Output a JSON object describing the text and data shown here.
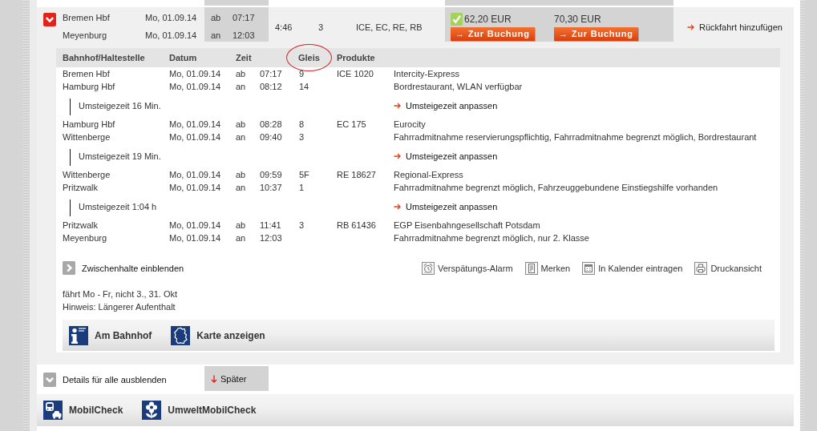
{
  "connection": {
    "expanded": true,
    "stations": [
      {
        "name": "Bremen Hbf",
        "date": "Mo, 01.09.14",
        "event": "ab",
        "time": "07:17"
      },
      {
        "name": "Meyenburg",
        "date": "Mo, 01.09.14",
        "event": "an",
        "time": "12:03"
      }
    ],
    "duration": "4:46",
    "changes": "3",
    "products": "ICE, EC, RE, RB",
    "fares": [
      {
        "price": "62,20 EUR",
        "selected": true,
        "button": "→ Zur Buchung"
      },
      {
        "price": "70,30 EUR",
        "selected": false,
        "button": "→ Zur Buchung"
      }
    ],
    "return_link": "Rückfahrt hinzufügen"
  },
  "details": {
    "columns": [
      {
        "label": "Bahnhof/Haltestelle",
        "circled": false
      },
      {
        "label": "Datum",
        "circled": false
      },
      {
        "label": "Zeit",
        "circled": false
      },
      {
        "label": "Gleis",
        "circled": true
      },
      {
        "label": "Produkte",
        "circled": false
      }
    ],
    "sections": [
      {
        "kind": "leg",
        "train": "ICE 1020",
        "stops": [
          {
            "station": "Bremen Hbf",
            "date": "Mo, 01.09.14",
            "event": "ab",
            "time": "07:17",
            "platform": "9",
            "info": "Intercity-Express"
          },
          {
            "station": "Hamburg Hbf",
            "date": "Mo, 01.09.14",
            "event": "an",
            "time": "08:12",
            "platform": "14",
            "info": "Bordrestaurant, WLAN verfügbar"
          }
        ]
      },
      {
        "kind": "transfer",
        "text": "Umsteigezeit 16 Min.",
        "link": "Umsteigezeit anpassen"
      },
      {
        "kind": "leg",
        "train": "EC 175",
        "stops": [
          {
            "station": "Hamburg Hbf",
            "date": "Mo, 01.09.14",
            "event": "ab",
            "time": "08:28",
            "platform": "8",
            "info": "Eurocity"
          },
          {
            "station": "Wittenberge",
            "date": "Mo, 01.09.14",
            "event": "an",
            "time": "09:40",
            "platform": "3",
            "info": "Fahrradmitnahme reservierungspflichtig, Fahrradmitnahme begrenzt möglich, Bordrestaurant"
          }
        ]
      },
      {
        "kind": "transfer",
        "text": "Umsteigezeit 19 Min.",
        "link": "Umsteigezeit anpassen"
      },
      {
        "kind": "leg",
        "train": "RE 18627",
        "stops": [
          {
            "station": "Wittenberge",
            "date": "Mo, 01.09.14",
            "event": "ab",
            "time": "09:59",
            "platform": "5F",
            "info": "Regional-Express"
          },
          {
            "station": "Pritzwalk",
            "date": "Mo, 01.09.14",
            "event": "an",
            "time": "10:37",
            "platform": "1",
            "info": "Fahrradmitnahme begrenzt möglich, Fahrzeuggebundene Einstiegshilfe vorhanden"
          }
        ]
      },
      {
        "kind": "transfer",
        "text": "Umsteigezeit 1:04 h",
        "link": "Umsteigezeit anpassen"
      },
      {
        "kind": "leg",
        "train": "RB 61436",
        "stops": [
          {
            "station": "Pritzwalk",
            "date": "Mo, 01.09.14",
            "event": "ab",
            "time": "11:41",
            "platform": "3",
            "info": "EGP Eisenbahngesellschaft Potsdam"
          },
          {
            "station": "Meyenburg",
            "date": "Mo, 01.09.14",
            "event": "an",
            "time": "12:03",
            "info": "Fahrradmitnahme begrenzt möglich, nur 2. Klasse"
          }
        ]
      }
    ],
    "stops_toggle": {
      "label": "Zwischenhalte einblenden",
      "expanded": false
    },
    "tools": [
      {
        "kind": "alarm",
        "label": "Verspätungs-Alarm"
      },
      {
        "kind": "bookmark",
        "label": "Merken"
      },
      {
        "kind": "calendar",
        "label": "In Kalender eintragen"
      },
      {
        "kind": "print",
        "label": "Druckansicht"
      }
    ],
    "notes": [
      "fährt Mo - Fr, nicht 3., 31. Okt",
      "Hinweis: Längerer Aufenthalt"
    ],
    "services": [
      {
        "kind": "station_info",
        "label": "Am Bahnhof"
      },
      {
        "kind": "map",
        "label": "Karte anzeigen"
      }
    ]
  },
  "details_toggle": {
    "label": "Details für alle ausblenden"
  },
  "later_button": "Später",
  "promos": [
    {
      "kind": "mobility",
      "label": "MobilCheck"
    },
    {
      "kind": "environment",
      "label": "UmweltMobilCheck"
    }
  ]
}
